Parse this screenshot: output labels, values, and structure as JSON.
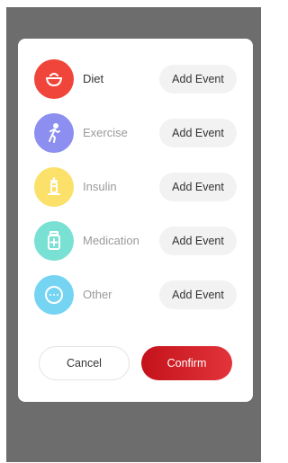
{
  "dialog": {
    "rows": [
      {
        "label": "Diet",
        "button": "Add Event",
        "icon": "bowl-icon",
        "color": "#f0453a"
      },
      {
        "label": "Exercise",
        "button": "Add Event",
        "icon": "running-person-icon",
        "color": "#8c8ff0"
      },
      {
        "label": "Insulin",
        "button": "Add Event",
        "icon": "syringe-icon",
        "color": "#fbe06a"
      },
      {
        "label": "Medication",
        "button": "Add Event",
        "icon": "medicine-bottle-icon",
        "color": "#79e0d4"
      },
      {
        "label": "Other",
        "button": "Add Event",
        "icon": "more-dots-icon",
        "color": "#74d4f2"
      }
    ],
    "cancel_label": "Cancel",
    "confirm_label": "Confirm",
    "confirm_color": "#d52027"
  }
}
